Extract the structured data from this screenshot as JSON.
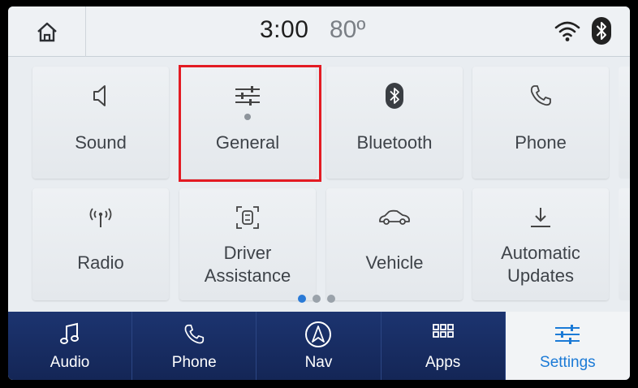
{
  "status": {
    "time": "3:00",
    "temperature": "80º"
  },
  "tiles": [
    {
      "label": "Sound",
      "icon": "speaker-icon"
    },
    {
      "label": "General",
      "icon": "sliders-icon"
    },
    {
      "label": "Bluetooth",
      "icon": "bluetooth-icon"
    },
    {
      "label": "Phone",
      "icon": "phone-icon"
    },
    {
      "label_line1": "",
      "label": "Radio",
      "icon": "radio-antenna-icon"
    },
    {
      "label_line1": "Driver",
      "label_line2": "Assistance",
      "icon": "driver-assist-icon"
    },
    {
      "label": "Vehicle",
      "icon": "car-icon"
    },
    {
      "label_line1": "Automatic",
      "label_line2": "Updates",
      "icon": "download-icon"
    }
  ],
  "pager": {
    "pages": 3,
    "current": 1
  },
  "nav": [
    {
      "label": "Audio",
      "icon": "music-note-icon"
    },
    {
      "label": "Phone",
      "icon": "phone-icon"
    },
    {
      "label": "Nav",
      "icon": "navigation-icon"
    },
    {
      "label": "Apps",
      "icon": "apps-grid-icon"
    },
    {
      "label": "Settings",
      "icon": "sliders-icon",
      "active": true
    }
  ],
  "colors": {
    "highlight": "#e31b23",
    "accent": "#1b7ad6",
    "nav_bg": "#1c3470"
  }
}
